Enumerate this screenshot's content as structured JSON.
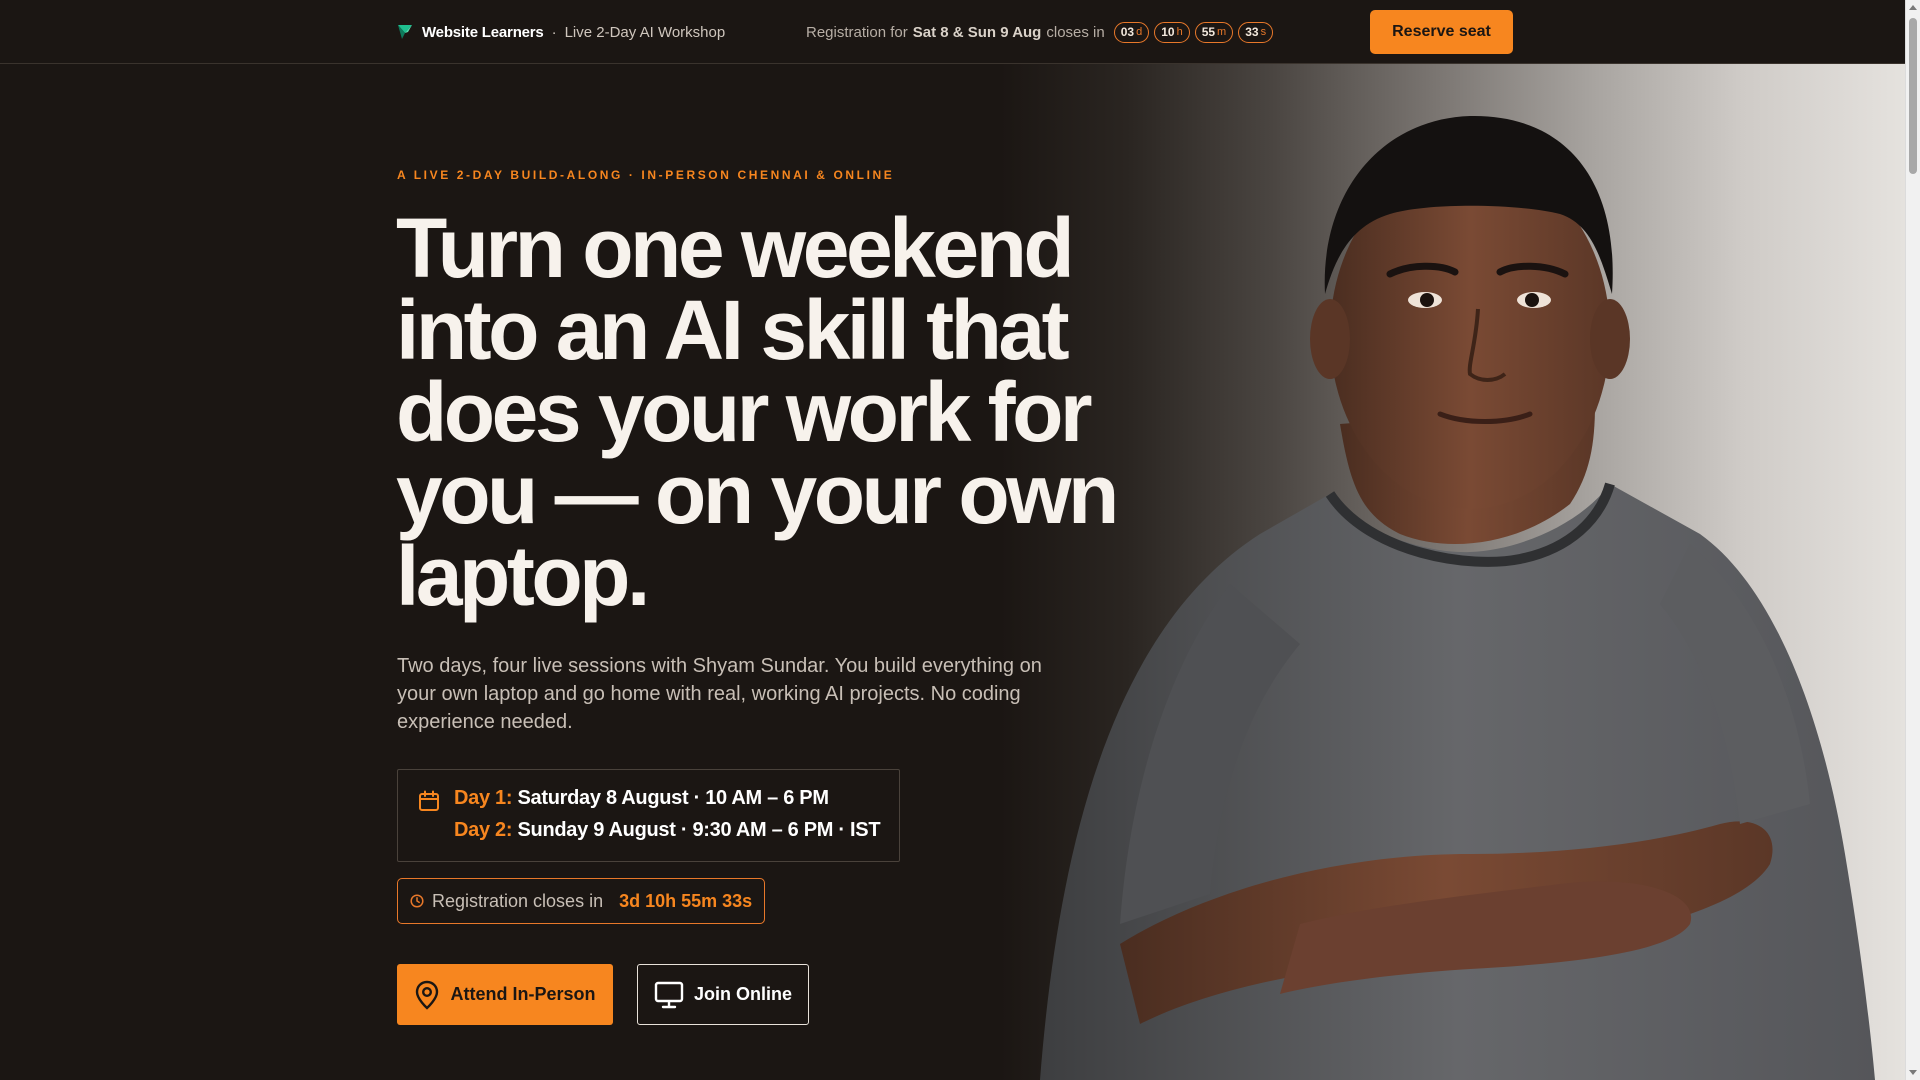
{
  "topbar": {
    "brand_name": "Website Learners",
    "brand_separator": "·",
    "brand_subtitle": "Live 2-Day AI Workshop",
    "registration_prefix": "Registration for",
    "registration_dates": "Sat 8 & Sun 9 Aug",
    "registration_suffix": "closes in",
    "countdown": [
      {
        "value": "03",
        "unit": "d"
      },
      {
        "value": "10",
        "unit": "h"
      },
      {
        "value": "55",
        "unit": "m"
      },
      {
        "value": "33",
        "unit": "s"
      }
    ],
    "reserve_label": "Reserve seat"
  },
  "hero": {
    "eyebrow": "A LIVE 2-DAY BUILD-ALONG · IN-PERSON CHENNAI & ONLINE",
    "headline_lines": [
      "Turn one weekend",
      "into an AI skill that",
      "does your work for",
      "you — on your own",
      "laptop."
    ],
    "lede": "Two days, four live sessions with Shyam Sundar. You build everything on your own laptop and go home with real, working AI projects. No coding experience needed.",
    "schedule": {
      "day1_label": "Day 1:",
      "day1_text": "Saturday 8 August · 10 AM – 6 PM",
      "day2_label": "Day 2:",
      "day2_text": "Sunday 9 August · 9:30 AM – 6 PM · IST"
    },
    "closes_label": "Registration closes in",
    "closes_count": "3d 10h 55m 33s",
    "cta_in_person": "Attend In-Person",
    "cta_online": "Join Online"
  },
  "colors": {
    "background": "#1b1613",
    "accent": "#f7861f",
    "text": "#f7f2ec"
  },
  "icons": {
    "brand": "brand-logo-icon",
    "calendar": "calendar-icon",
    "clock": "clock-icon",
    "location": "location-pin-icon",
    "monitor": "monitor-icon"
  }
}
